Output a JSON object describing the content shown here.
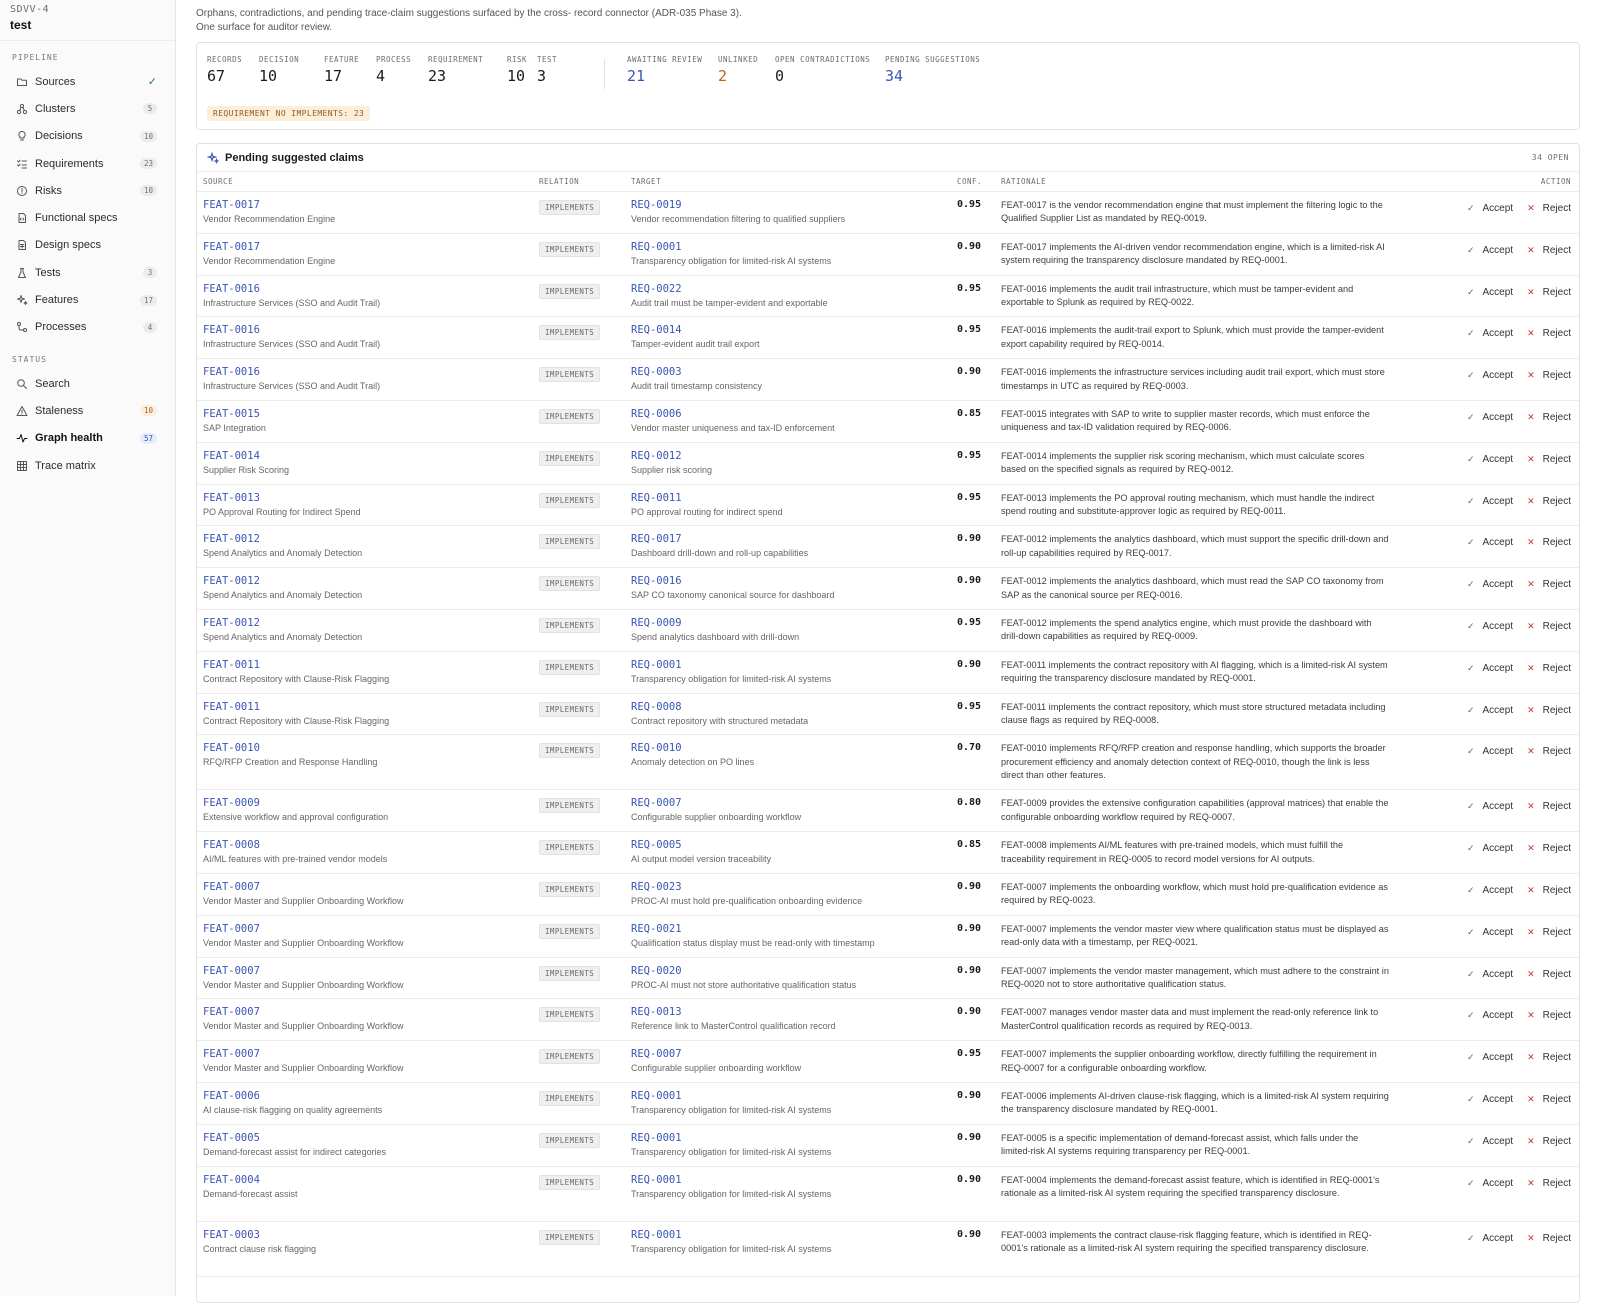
{
  "brand": {
    "code": "SDVV-4",
    "name": "test"
  },
  "sidebar": {
    "pipeline_title": "PIPELINE",
    "status_title": "STATUS",
    "pipeline_items": [
      {
        "label": "Sources",
        "badge": "",
        "check": true,
        "icon": "folder-icon"
      },
      {
        "label": "Clusters",
        "badge": "5",
        "icon": "clusters-icon"
      },
      {
        "label": "Decisions",
        "badge": "10",
        "icon": "lightbulb-icon"
      },
      {
        "label": "Requirements",
        "badge": "23",
        "icon": "list-check-icon"
      },
      {
        "label": "Risks",
        "badge": "10",
        "icon": "alert-circle-icon"
      },
      {
        "label": "Functional specs",
        "badge": "",
        "icon": "doc-code-icon"
      },
      {
        "label": "Design specs",
        "badge": "",
        "icon": "doc-grid-icon"
      },
      {
        "label": "Tests",
        "badge": "3",
        "icon": "flask-icon"
      },
      {
        "label": "Features",
        "badge": "17",
        "icon": "sparkles-icon"
      },
      {
        "label": "Processes",
        "badge": "4",
        "icon": "workflow-icon"
      }
    ],
    "status_items": [
      {
        "label": "Search",
        "badge": "",
        "icon": "search-icon"
      },
      {
        "label": "Staleness",
        "badge": "10",
        "badge_style": "warn",
        "icon": "warning-icon"
      },
      {
        "label": "Graph health",
        "badge": "57",
        "badge_style": "info",
        "icon": "pulse-icon",
        "active": true
      },
      {
        "label": "Trace matrix",
        "badge": "",
        "icon": "grid-icon"
      }
    ]
  },
  "intro": {
    "line1": "Orphans, contradictions, and pending trace-claim suggestions surfaced by the cross- record connector (ADR-035 Phase 3).",
    "line2": "One surface for auditor review."
  },
  "stats": {
    "group1": [
      {
        "label": "RECORDS",
        "value": "67"
      },
      {
        "label": "DECISION",
        "value": "10"
      },
      {
        "label": "FEATURE",
        "value": "17"
      },
      {
        "label": "PROCESS",
        "value": "4"
      },
      {
        "label": "REQUIREMENT",
        "value": "23"
      },
      {
        "label": "RISK",
        "value": "10"
      },
      {
        "label": "TEST",
        "value": "3"
      }
    ],
    "group2": [
      {
        "label": "AWAITING REVIEW",
        "value": "21",
        "color": "#3a55b5"
      },
      {
        "label": "UNLINKED",
        "value": "2",
        "color": "#b5651d"
      },
      {
        "label": "OPEN CONTRADICTIONS",
        "value": "0",
        "color": "#1a1a1a"
      },
      {
        "label": "PENDING SUGGESTIONS",
        "value": "34",
        "color": "#3a55b5"
      }
    ],
    "warning_chip": "REQUIREMENT NO IMPLEMENTS: 23"
  },
  "claims": {
    "title": "Pending suggested claims",
    "count": "34 OPEN",
    "columns": {
      "source": "SOURCE",
      "relation": "RELATION",
      "target": "TARGET",
      "conf": "CONF.",
      "rationale": "RATIONALE",
      "action": "ACTION"
    },
    "accept_label": "Accept",
    "reject_label": "Reject",
    "rows": [
      {
        "src": "FEAT-0017",
        "src_name": "Vendor Recommendation Engine",
        "rel": "IMPLEMENTS",
        "tgt": "REQ-0019",
        "tgt_name": "Vendor recommendation filtering to qualified suppliers",
        "conf": "0.95",
        "rationale": "FEAT-0017 is the vendor recommendation engine that must implement the filtering logic to the Qualified Supplier List as mandated by REQ-0019."
      },
      {
        "src": "FEAT-0017",
        "src_name": "Vendor Recommendation Engine",
        "rel": "IMPLEMENTS",
        "tgt": "REQ-0001",
        "tgt_name": "Transparency obligation for limited-risk AI systems",
        "conf": "0.90",
        "rationale": "FEAT-0017 implements the AI-driven vendor recommendation engine, which is a limited-risk AI system requiring the transparency disclosure mandated by REQ-0001."
      },
      {
        "src": "FEAT-0016",
        "src_name": "Infrastructure Services (SSO and Audit Trail)",
        "rel": "IMPLEMENTS",
        "tgt": "REQ-0022",
        "tgt_name": "Audit trail must be tamper-evident and exportable",
        "conf": "0.95",
        "rationale": "FEAT-0016 implements the audit trail infrastructure, which must be tamper-evident and exportable to Splunk as required by REQ-0022."
      },
      {
        "src": "FEAT-0016",
        "src_name": "Infrastructure Services (SSO and Audit Trail)",
        "rel": "IMPLEMENTS",
        "tgt": "REQ-0014",
        "tgt_name": "Tamper-evident audit trail export",
        "conf": "0.95",
        "rationale": "FEAT-0016 implements the audit-trail export to Splunk, which must provide the tamper-evident export capability required by REQ-0014."
      },
      {
        "src": "FEAT-0016",
        "src_name": "Infrastructure Services (SSO and Audit Trail)",
        "rel": "IMPLEMENTS",
        "tgt": "REQ-0003",
        "tgt_name": "Audit trail timestamp consistency",
        "conf": "0.90",
        "rationale": "FEAT-0016 implements the infrastructure services including audit trail export, which must store timestamps in UTC as required by REQ-0003."
      },
      {
        "src": "FEAT-0015",
        "src_name": "SAP Integration",
        "rel": "IMPLEMENTS",
        "tgt": "REQ-0006",
        "tgt_name": "Vendor master uniqueness and tax-ID enforcement",
        "conf": "0.85",
        "rationale": "FEAT-0015 integrates with SAP to write to supplier master records, which must enforce the uniqueness and tax-ID validation required by REQ-0006."
      },
      {
        "src": "FEAT-0014",
        "src_name": "Supplier Risk Scoring",
        "rel": "IMPLEMENTS",
        "tgt": "REQ-0012",
        "tgt_name": "Supplier risk scoring",
        "conf": "0.95",
        "rationale": "FEAT-0014 implements the supplier risk scoring mechanism, which must calculate scores based on the specified signals as required by REQ-0012."
      },
      {
        "src": "FEAT-0013",
        "src_name": "PO Approval Routing for Indirect Spend",
        "rel": "IMPLEMENTS",
        "tgt": "REQ-0011",
        "tgt_name": "PO approval routing for indirect spend",
        "conf": "0.95",
        "rationale": "FEAT-0013 implements the PO approval routing mechanism, which must handle the indirect spend routing and substitute-approver logic as required by REQ-0011."
      },
      {
        "src": "FEAT-0012",
        "src_name": "Spend Analytics and Anomaly Detection",
        "rel": "IMPLEMENTS",
        "tgt": "REQ-0017",
        "tgt_name": "Dashboard drill-down and roll-up capabilities",
        "conf": "0.90",
        "rationale": "FEAT-0012 implements the analytics dashboard, which must support the specific drill-down and roll-up capabilities required by REQ-0017."
      },
      {
        "src": "FEAT-0012",
        "src_name": "Spend Analytics and Anomaly Detection",
        "rel": "IMPLEMENTS",
        "tgt": "REQ-0016",
        "tgt_name": "SAP CO taxonomy canonical source for dashboard",
        "conf": "0.90",
        "rationale": "FEAT-0012 implements the analytics dashboard, which must read the SAP CO taxonomy from SAP as the canonical source per REQ-0016."
      },
      {
        "src": "FEAT-0012",
        "src_name": "Spend Analytics and Anomaly Detection",
        "rel": "IMPLEMENTS",
        "tgt": "REQ-0009",
        "tgt_name": "Spend analytics dashboard with drill-down",
        "conf": "0.95",
        "rationale": "FEAT-0012 implements the spend analytics engine, which must provide the dashboard with drill-down capabilities as required by REQ-0009."
      },
      {
        "src": "FEAT-0011",
        "src_name": "Contract Repository with Clause-Risk Flagging",
        "rel": "IMPLEMENTS",
        "tgt": "REQ-0001",
        "tgt_name": "Transparency obligation for limited-risk AI systems",
        "conf": "0.90",
        "rationale": "FEAT-0011 implements the contract repository with AI flagging, which is a limited-risk AI system requiring the transparency disclosure mandated by REQ-0001."
      },
      {
        "src": "FEAT-0011",
        "src_name": "Contract Repository with Clause-Risk Flagging",
        "rel": "IMPLEMENTS",
        "tgt": "REQ-0008",
        "tgt_name": "Contract repository with structured metadata",
        "conf": "0.95",
        "rationale": "FEAT-0011 implements the contract repository, which must store structured metadata including clause flags as required by REQ-0008."
      },
      {
        "src": "FEAT-0010",
        "src_name": "RFQ/RFP Creation and Response Handling",
        "rel": "IMPLEMENTS",
        "tgt": "REQ-0010",
        "tgt_name": "Anomaly detection on PO lines",
        "conf": "0.70",
        "rationale": "FEAT-0010 implements RFQ/RFP creation and response handling, which supports the broader procurement efficiency and anomaly detection context of REQ-0010, though the link is less direct than other features.",
        "tall": true
      },
      {
        "src": "FEAT-0009",
        "src_name": "Extensive workflow and approval configuration",
        "rel": "IMPLEMENTS",
        "tgt": "REQ-0007",
        "tgt_name": "Configurable supplier onboarding workflow",
        "conf": "0.80",
        "rationale": "FEAT-0009 provides the extensive configuration capabilities (approval matrices) that enable the configurable onboarding workflow required by REQ-0007."
      },
      {
        "src": "FEAT-0008",
        "src_name": "AI/ML features with pre-trained vendor models",
        "rel": "IMPLEMENTS",
        "tgt": "REQ-0005",
        "tgt_name": "AI output model version traceability",
        "conf": "0.85",
        "rationale": "FEAT-0008 implements AI/ML features with pre-trained models, which must fulfill the traceability requirement in REQ-0005 to record model versions for AI outputs."
      },
      {
        "src": "FEAT-0007",
        "src_name": "Vendor Master and Supplier Onboarding Workflow",
        "rel": "IMPLEMENTS",
        "tgt": "REQ-0023",
        "tgt_name": "PROC-AI must hold pre-qualification onboarding evidence",
        "conf": "0.90",
        "rationale": "FEAT-0007 implements the onboarding workflow, which must hold pre-qualification evidence as required by REQ-0023."
      },
      {
        "src": "FEAT-0007",
        "src_name": "Vendor Master and Supplier Onboarding Workflow",
        "rel": "IMPLEMENTS",
        "tgt": "REQ-0021",
        "tgt_name": "Qualification status display must be read-only with timestamp",
        "conf": "0.90",
        "rationale": "FEAT-0007 implements the vendor master view where qualification status must be displayed as read-only data with a timestamp, per REQ-0021."
      },
      {
        "src": "FEAT-0007",
        "src_name": "Vendor Master and Supplier Onboarding Workflow",
        "rel": "IMPLEMENTS",
        "tgt": "REQ-0020",
        "tgt_name": "PROC-AI must not store authoritative qualification status",
        "conf": "0.90",
        "rationale": "FEAT-0007 implements the vendor master management, which must adhere to the constraint in REQ-0020 not to store authoritative qualification status."
      },
      {
        "src": "FEAT-0007",
        "src_name": "Vendor Master and Supplier Onboarding Workflow",
        "rel": "IMPLEMENTS",
        "tgt": "REQ-0013",
        "tgt_name": "Reference link to MasterControl qualification record",
        "conf": "0.90",
        "rationale": "FEAT-0007 manages vendor master data and must implement the read-only reference link to MasterControl qualification records as required by REQ-0013."
      },
      {
        "src": "FEAT-0007",
        "src_name": "Vendor Master and Supplier Onboarding Workflow",
        "rel": "IMPLEMENTS",
        "tgt": "REQ-0007",
        "tgt_name": "Configurable supplier onboarding workflow",
        "conf": "0.95",
        "rationale": "FEAT-0007 implements the supplier onboarding workflow, directly fulfilling the requirement in REQ-0007 for a configurable onboarding workflow."
      },
      {
        "src": "FEAT-0006",
        "src_name": "AI clause-risk flagging on quality agreements",
        "rel": "IMPLEMENTS",
        "tgt": "REQ-0001",
        "tgt_name": "Transparency obligation for limited-risk AI systems",
        "conf": "0.90",
        "rationale": "FEAT-0006 implements AI-driven clause-risk flagging, which is a limited-risk AI system requiring the transparency disclosure mandated by REQ-0001."
      },
      {
        "src": "FEAT-0005",
        "src_name": "Demand-forecast assist for indirect categories",
        "rel": "IMPLEMENTS",
        "tgt": "REQ-0001",
        "tgt_name": "Transparency obligation for limited-risk AI systems",
        "conf": "0.90",
        "rationale": "FEAT-0005 is a specific implementation of demand-forecast assist, which falls under the limited-risk AI systems requiring transparency per REQ-0001."
      },
      {
        "src": "FEAT-0004",
        "src_name": "Demand-forecast assist",
        "rel": "IMPLEMENTS",
        "tgt": "REQ-0001",
        "tgt_name": "Transparency obligation for limited-risk AI systems",
        "conf": "0.90",
        "rationale": "FEAT-0004 implements the demand-forecast assist feature, which is identified in REQ-0001's rationale as a limited-risk AI system requiring the specified transparency disclosure.",
        "tall": true
      },
      {
        "src": "FEAT-0003",
        "src_name": "Contract clause risk flagging",
        "rel": "IMPLEMENTS",
        "tgt": "REQ-0001",
        "tgt_name": "Transparency obligation for limited-risk AI systems",
        "conf": "0.90",
        "rationale": "FEAT-0003 implements the contract clause-risk flagging feature, which is identified in REQ-0001's rationale as a limited-risk AI system requiring the specified transparency disclosure.",
        "tall": true
      }
    ]
  }
}
